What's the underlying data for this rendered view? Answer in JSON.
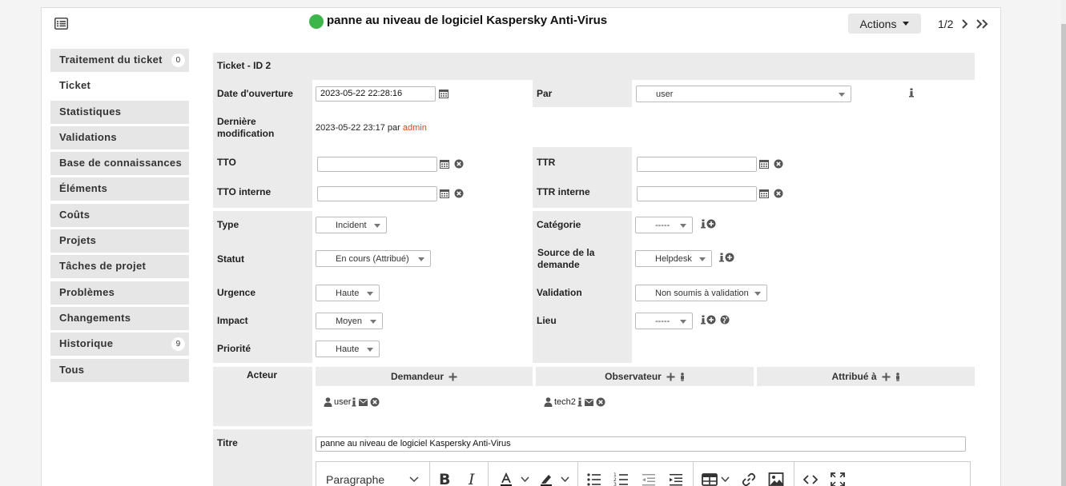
{
  "header": {
    "title": "panne au niveau de logiciel Kaspersky Anti-Virus",
    "status_color": "#3db54a",
    "actions_label": "Actions",
    "pager": "1/2"
  },
  "tabs": [
    {
      "label": "Traitement du ticket",
      "count": "0"
    },
    {
      "label": "Ticket"
    },
    {
      "label": "Statistiques"
    },
    {
      "label": "Validations"
    },
    {
      "label": "Base de connaissances"
    },
    {
      "label": "Éléments"
    },
    {
      "label": "Coûts"
    },
    {
      "label": "Projets"
    },
    {
      "label": "Tâches de projet"
    },
    {
      "label": "Problèmes"
    },
    {
      "label": "Changements"
    },
    {
      "label": "Historique",
      "count": "9"
    },
    {
      "label": "Tous"
    }
  ],
  "ticket": {
    "heading": "Ticket - ID 2",
    "date_label": "Date d'ouverture",
    "date_value": "2023-05-22 22:28:16",
    "par_label": "Par",
    "par_value": "user",
    "modif_label_1": "Dernière",
    "modif_label_2": "modification",
    "modif_value": "2023-05-22 23:17 par",
    "modif_user": "admin",
    "tto_label": "TTO",
    "ttr_label": "TTR",
    "tto_int_label": "TTO interne",
    "ttr_int_label": "TTR interne",
    "type_label": "Type",
    "type_value": "Incident",
    "cat_label": "Catégorie",
    "cat_value": "-----",
    "statut_label": "Statut",
    "statut_value": "En cours (Attribué)",
    "source_label_1": "Source de la",
    "source_label_2": "demande",
    "source_value": "Helpdesk",
    "urgence_label": "Urgence",
    "urgence_value": "Haute",
    "validation_label": "Validation",
    "validation_value": "Non soumis à validation",
    "impact_label": "Impact",
    "impact_value": "Moyen",
    "lieu_label": "Lieu",
    "lieu_value": "-----",
    "priorite_label": "Priorité",
    "priorite_value": "Haute"
  },
  "actors": {
    "label": "Acteur",
    "demandeur": "Demandeur",
    "observateur": "Observateur",
    "attribue": "Attribué à",
    "demandeur_user": "user",
    "observateur_user": "tech2"
  },
  "titre": {
    "label": "Titre",
    "value": "panne au niveau de logiciel Kaspersky Anti-Virus"
  },
  "editor": {
    "paragraph": "Paragraphe"
  }
}
